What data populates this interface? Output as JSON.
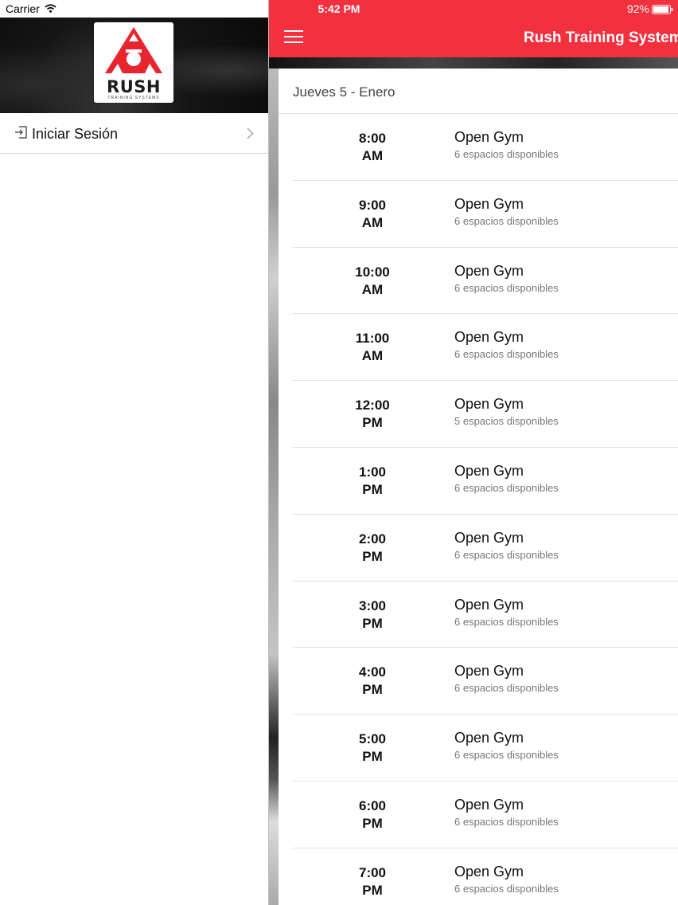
{
  "status_bar": {
    "carrier": "Carrier",
    "time": "5:42 PM",
    "battery": "92%"
  },
  "drawer": {
    "logo": {
      "word": "RUSH",
      "sub": "TRAINING SYSTEMS"
    },
    "items": [
      {
        "label": "Iniciar Sesión",
        "icon": "login-icon"
      }
    ]
  },
  "header": {
    "title": "Rush Training System",
    "menu_icon": "hamburger-icon"
  },
  "schedule": {
    "date_label": "Jueves 5 - Enero",
    "slots": [
      {
        "time": "8:00",
        "period": "AM",
        "name": "Open Gym",
        "availability": "6 espacios disponibles"
      },
      {
        "time": "9:00",
        "period": "AM",
        "name": "Open Gym",
        "availability": "6 espacios disponibles"
      },
      {
        "time": "10:00",
        "period": "AM",
        "name": "Open Gym",
        "availability": "6 espacios disponibles"
      },
      {
        "time": "11:00",
        "period": "AM",
        "name": "Open Gym",
        "availability": "6 espacios disponibles"
      },
      {
        "time": "12:00",
        "period": "PM",
        "name": "Open Gym",
        "availability": "5 espacios disponibles"
      },
      {
        "time": "1:00",
        "period": "PM",
        "name": "Open Gym",
        "availability": "6 espacios disponibles"
      },
      {
        "time": "2:00",
        "period": "PM",
        "name": "Open Gym",
        "availability": "6 espacios disponibles"
      },
      {
        "time": "3:00",
        "period": "PM",
        "name": "Open Gym",
        "availability": "6 espacios disponibles"
      },
      {
        "time": "4:00",
        "period": "PM",
        "name": "Open Gym",
        "availability": "6 espacios disponibles"
      },
      {
        "time": "5:00",
        "period": "PM",
        "name": "Open Gym",
        "availability": "6 espacios disponibles"
      },
      {
        "time": "6:00",
        "period": "PM",
        "name": "Open Gym",
        "availability": "6 espacios disponibles"
      },
      {
        "time": "7:00",
        "period": "PM",
        "name": "Open Gym",
        "availability": "6 espacios disponibles"
      }
    ]
  },
  "colors": {
    "accent": "#f2303e",
    "logo_red": "#e8252f"
  }
}
